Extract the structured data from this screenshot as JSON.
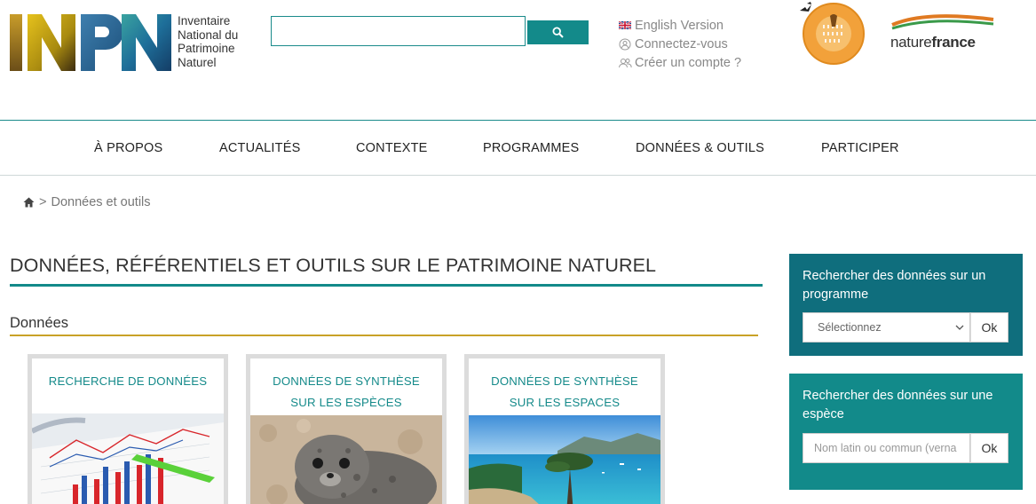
{
  "header": {
    "logo_lines": [
      "Inventaire",
      "National du",
      "Patrimoine",
      "Naturel"
    ],
    "search": {
      "value": "",
      "placeholder": ""
    },
    "links": {
      "english": "English Version",
      "login": "Connectez-vous",
      "register": "Créer un compte ?"
    },
    "partner_logo_text_light": "nature",
    "partner_logo_text_bold": "france"
  },
  "nav": {
    "items": [
      "À PROPOS",
      "ACTUALITÉS",
      "CONTEXTE",
      "PROGRAMMES",
      "DONNÉES & OUTILS",
      "PARTICIPER"
    ]
  },
  "breadcrumb": {
    "separator": ">",
    "current": "Données et outils"
  },
  "main": {
    "title": "DONNÉES, RÉFÉRENTIELS ET OUTILS SUR LE PATRIMOINE NATUREL",
    "section": "Données",
    "cards": [
      {
        "line1": "RECHERCHE DE DONNÉES",
        "line2": ""
      },
      {
        "line1": "DONNÉES DE SYNTHÈSE",
        "line2": "SUR LES ESPÈCES"
      },
      {
        "line1": "DONNÉES DE SYNTHÈSE",
        "line2": "SUR LES ESPACES"
      }
    ]
  },
  "sidebar": {
    "program_box": {
      "title": "Rechercher des données sur un programme",
      "select_value": "Sélectionnez",
      "ok_label": "Ok"
    },
    "species_box": {
      "title": "Rechercher des données sur une espèce",
      "placeholder": "Nom latin ou commun (verna",
      "ok_label": "Ok"
    }
  },
  "colors": {
    "teal": "#138a8a",
    "dark_teal": "#0f6e7d",
    "gold": "#c9a227"
  }
}
